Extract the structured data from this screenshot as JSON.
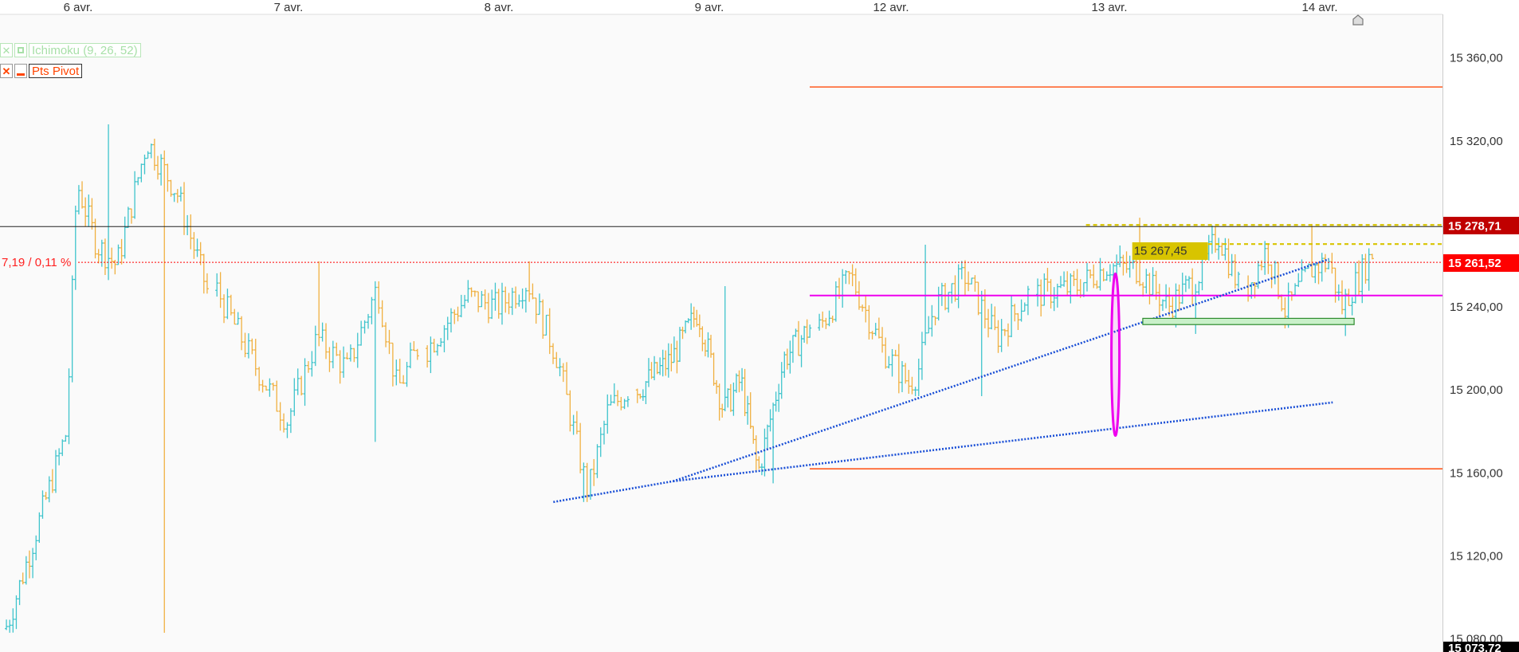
{
  "chart_data": {
    "type": "ohlc",
    "x_tick_labels": [
      "6 avr.",
      "7 avr.",
      "8 avr.",
      "9 avr.",
      "12 avr.",
      "13 avr.",
      "14 avr."
    ],
    "y_tick_values": [
      15080,
      15120,
      15160,
      15200,
      15240,
      15280,
      15320,
      15360
    ],
    "y_tick_labels": [
      "15 080,00",
      "15 120,00",
      "15 160,00",
      "15 200,00",
      "15 240,00",
      "15 280,00",
      "15 320,00",
      "15 360,00"
    ],
    "ylim": [
      15073.72,
      15381
    ],
    "price_badges": {
      "current": {
        "value": 15278.71,
        "label": "15 278,71",
        "color": "#c00000"
      },
      "level": {
        "value": 15267.45,
        "label": "15 267,45",
        "color": "#d8c400"
      },
      "previous_close": {
        "value": 15261.52,
        "label": "15 261,52",
        "color": "#ff0000"
      },
      "low": {
        "value": 15073.72,
        "label": "15 073,72",
        "color": "#000000"
      }
    },
    "variation_label": "7,19 / 0,11 %",
    "indicators": [
      {
        "name": "Ichimoku (9, 26, 52)",
        "color": "#a8e0a8"
      },
      {
        "name": "Pts Pivot",
        "color": "#ff4400"
      }
    ],
    "pivot_levels": [
      15346,
      15162
    ],
    "pivot_color": "#ff5a1f",
    "magenta_level": 15245.5,
    "magenta_color": "#ee00ee",
    "trendline_color": "#1a4fd6",
    "dashed_level_color": "#d8c400",
    "up_color": "#3fc4cc",
    "down_color": "#f0b040",
    "sessions": [
      {
        "label": "6 avr.",
        "bars": 62,
        "start": 15085,
        "low": 15083,
        "high": 15328,
        "end": 15248,
        "path": [
          [
            0.0,
            15085
          ],
          [
            0.3,
            15180
          ],
          [
            0.35,
            15300
          ],
          [
            0.45,
            15270
          ],
          [
            0.55,
            15260
          ],
          [
            0.7,
            15320
          ],
          [
            0.85,
            15295
          ],
          [
            1.0,
            15248
          ]
        ]
      },
      {
        "label": "7 avr.",
        "bars": 58,
        "start": 15248,
        "low": 15175,
        "high": 15262,
        "end": 15220,
        "path": [
          [
            0.0,
            15248
          ],
          [
            0.2,
            15210
          ],
          [
            0.35,
            15185
          ],
          [
            0.5,
            15225
          ],
          [
            0.65,
            15210
          ],
          [
            0.8,
            15250
          ],
          [
            0.9,
            15200
          ],
          [
            1.0,
            15220
          ]
        ]
      },
      {
        "label": "8 avr.",
        "bars": 60,
        "start": 15220,
        "low": 15146,
        "high": 15262,
        "end": 15200,
        "path": [
          [
            0.0,
            15220
          ],
          [
            0.2,
            15245
          ],
          [
            0.35,
            15240
          ],
          [
            0.5,
            15252
          ],
          [
            0.65,
            15215
          ],
          [
            0.8,
            15150
          ],
          [
            0.9,
            15190
          ],
          [
            1.0,
            15200
          ]
        ]
      },
      {
        "label": "9 avr.",
        "bars": 62,
        "start": 15200,
        "low": 15155,
        "high": 15250,
        "end": 15230,
        "path": [
          [
            0.0,
            15200
          ],
          [
            0.2,
            15215
          ],
          [
            0.35,
            15238
          ],
          [
            0.5,
            15190
          ],
          [
            0.6,
            15205
          ],
          [
            0.7,
            15160
          ],
          [
            0.85,
            15215
          ],
          [
            1.0,
            15230
          ]
        ]
      },
      {
        "label": "12 avr.",
        "bars": 64,
        "start": 15230,
        "low": 15197,
        "high": 15270,
        "end": 15246,
        "path": [
          [
            0.0,
            15230
          ],
          [
            0.15,
            15255
          ],
          [
            0.3,
            15220
          ],
          [
            0.45,
            15200
          ],
          [
            0.55,
            15240
          ],
          [
            0.7,
            15255
          ],
          [
            0.85,
            15225
          ],
          [
            1.0,
            15246
          ]
        ]
      },
      {
        "label": "13 avr.",
        "bars": 62,
        "start": 15246,
        "low": 15227,
        "high": 15283,
        "end": 15250,
        "path": [
          [
            0.0,
            15246
          ],
          [
            0.2,
            15250
          ],
          [
            0.35,
            15260
          ],
          [
            0.5,
            15258
          ],
          [
            0.65,
            15240
          ],
          [
            0.8,
            15255
          ],
          [
            0.9,
            15275
          ],
          [
            1.0,
            15250
          ]
        ]
      },
      {
        "label": "14 avr.",
        "bars": 38,
        "start": 15250,
        "low": 15226,
        "high": 15280,
        "end": 15266,
        "path": [
          [
            0.0,
            15250
          ],
          [
            0.15,
            15268
          ],
          [
            0.3,
            15238
          ],
          [
            0.5,
            15258
          ],
          [
            0.65,
            15262
          ],
          [
            0.75,
            15240
          ],
          [
            0.9,
            15255
          ],
          [
            1.0,
            15266
          ]
        ]
      }
    ]
  }
}
